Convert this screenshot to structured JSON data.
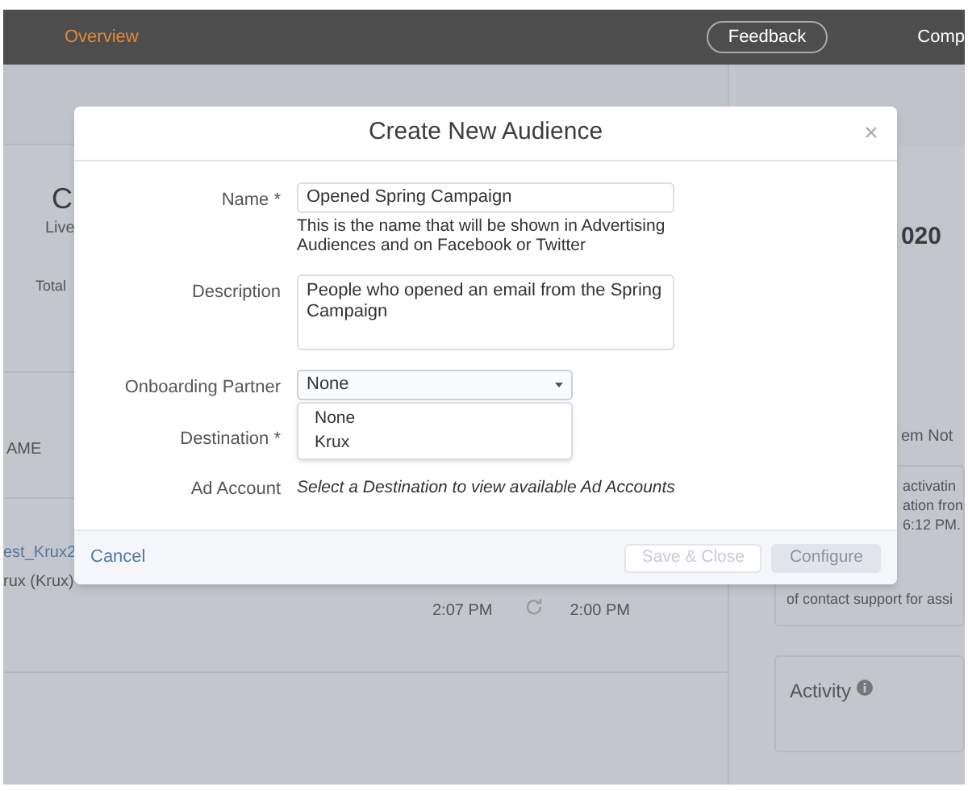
{
  "header": {
    "nav_item": "Overview",
    "feedback_button": "Feedback",
    "account_link": "Comp"
  },
  "background": {
    "stat_value": "C",
    "stat_label": "Live",
    "total_label": "Total",
    "date_value": "020",
    "table_header": "AME",
    "row": {
      "name": "est_Krux2",
      "source": "rux (Krux)",
      "time_1": "2:07 PM",
      "time_2": "2:00 PM"
    },
    "notice_title": "em Not",
    "notice_lines": [
      "activatin",
      "ation fron",
      "6:12 PM.",
      "of contact support for assi"
    ],
    "activity_title": "Activity"
  },
  "dialog": {
    "title": "Create New Audience",
    "fields": [
      {
        "kind": "text",
        "label": "Name *",
        "value": "Opened Spring Campaign",
        "help": "This is the name that will be shown in Advertising Audiences and on Facebook or Twitter"
      },
      {
        "kind": "textarea",
        "label": "Description",
        "value": "People who opened an email from the Spring Campaign"
      },
      {
        "kind": "select",
        "label": "Onboarding Partner",
        "value": "None",
        "expanded": true,
        "options": [
          "None",
          "Krux"
        ]
      },
      {
        "kind": "covered",
        "label": "Destination *"
      },
      {
        "kind": "note",
        "label": "Ad Account",
        "text": "Select a Destination to view available Ad Accounts"
      }
    ],
    "cancel": "Cancel",
    "buttons": [
      {
        "label": "Save & Close",
        "kind": "secondary",
        "disabled": true
      },
      {
        "label": "Configure",
        "kind": "primary",
        "disabled": true
      }
    ]
  }
}
